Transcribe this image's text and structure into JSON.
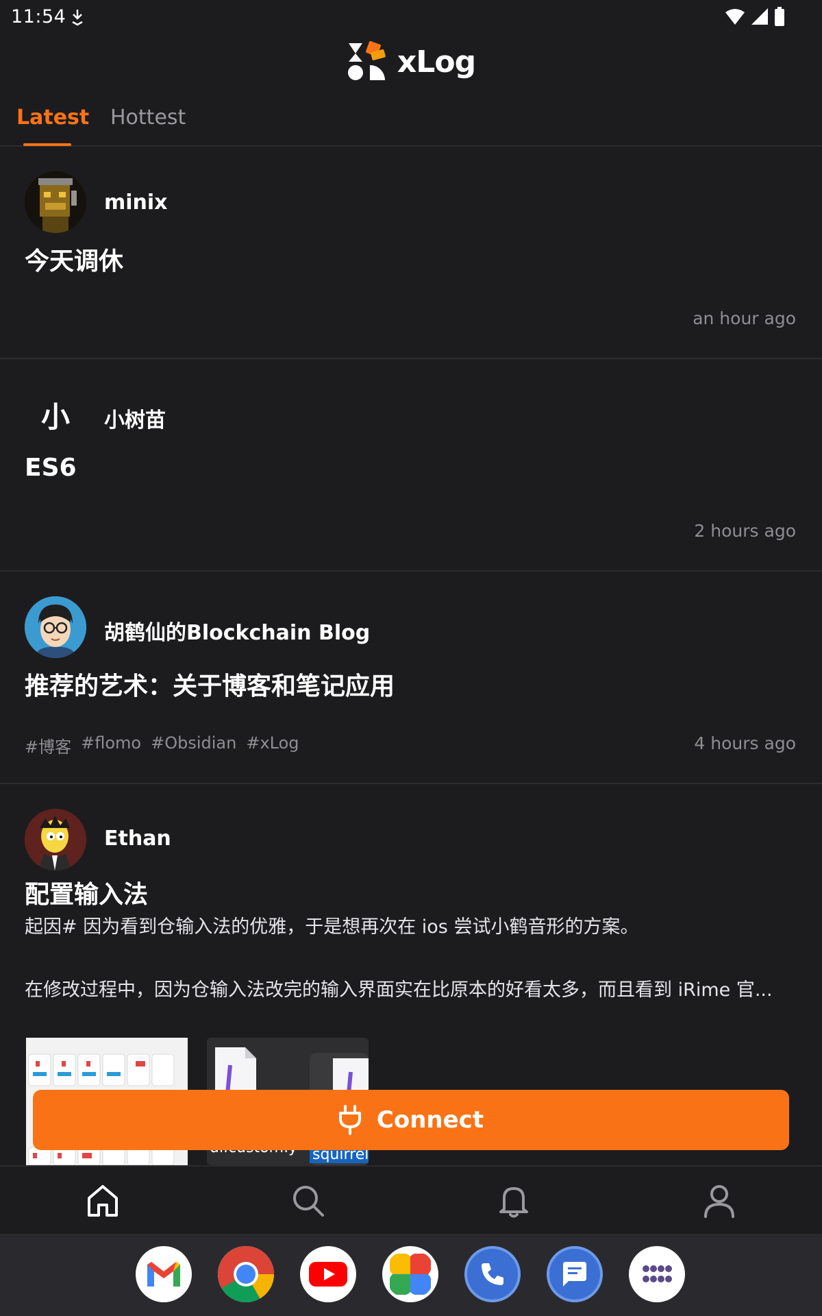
{
  "status_bar": {
    "time": "11:54"
  },
  "header": {
    "logo_text": "xLog"
  },
  "tabs": [
    {
      "label": "Latest",
      "active": true
    },
    {
      "label": "Hottest",
      "active": false
    }
  ],
  "posts": [
    {
      "author": "minix",
      "title": "今天调休",
      "time": "an hour ago",
      "tags": []
    },
    {
      "author": "小树苗",
      "avatar_char": "小",
      "title": "ES6",
      "time": "2 hours ago",
      "tags": []
    },
    {
      "author": "胡鹤仙的Blockchain Blog",
      "title": "推荐的艺术：关于博客和笔记应用",
      "time": "4 hours ago",
      "tags": [
        "#博客",
        "#flomo",
        "#Obsidian",
        "#xLog"
      ]
    },
    {
      "author": "Ethan",
      "title": "配置输入法",
      "excerpt_1": "起因# 因为看到仓输入法的优雅，于是想再次在 ios 尝试小鹤音形的方案。",
      "excerpt_2": "在修改过程中，因为仓输入法改完的输入界面实在比原本的好看太多，而且看到 iRime 官...",
      "thumb_2_caption_1": "ui.custom.y",
      "thumb_2_caption_2": "squirrel."
    }
  ],
  "connect_button": {
    "label": "Connect"
  },
  "bottom_nav": [
    "home-icon",
    "search-icon",
    "bell-icon",
    "user-icon"
  ],
  "dock": [
    "gmail-icon",
    "chrome-icon",
    "youtube-icon",
    "photos-icon",
    "phone-icon",
    "messages-icon",
    "app-drawer-icon"
  ],
  "colors": {
    "accent": "#f97316",
    "background": "#1c1c1e",
    "muted": "#8e8e93"
  }
}
